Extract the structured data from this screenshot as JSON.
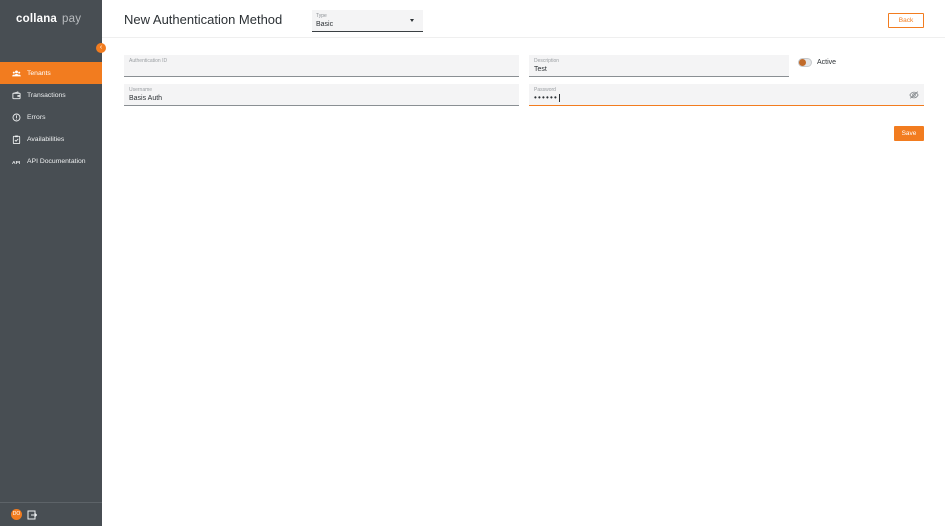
{
  "app": {
    "brand": "collana",
    "product": "pay"
  },
  "sidebar": {
    "collapse_icon": "chevron-left-icon",
    "items": [
      {
        "label": "Tenants",
        "icon": "users-icon",
        "active": true
      },
      {
        "label": "Transactions",
        "icon": "wallet-icon",
        "active": false
      },
      {
        "label": "Errors",
        "icon": "error-circle-icon",
        "active": false
      },
      {
        "label": "Availabilities",
        "icon": "clipboard-check-icon",
        "active": false
      },
      {
        "label": "API Documentation",
        "icon": "api-icon",
        "active": false
      }
    ],
    "footer": {
      "avatar_initials": "DO",
      "logout_icon": "logout-icon"
    }
  },
  "header": {
    "title": "New Authentication Method",
    "type_select": {
      "label": "Type",
      "value": "Basic"
    },
    "back_label": "Back"
  },
  "form": {
    "authentication_id": {
      "label": "Authentication ID",
      "value": ""
    },
    "description": {
      "label": "Description",
      "value": "Test"
    },
    "active": {
      "label": "Active",
      "checked": false
    },
    "username": {
      "label": "Username",
      "value": "Basis Auth"
    },
    "password": {
      "label": "Password",
      "masked_value": "••••••"
    },
    "save_label": "Save"
  },
  "colors": {
    "accent": "#f27c1f",
    "sidebar": "#484e53"
  }
}
